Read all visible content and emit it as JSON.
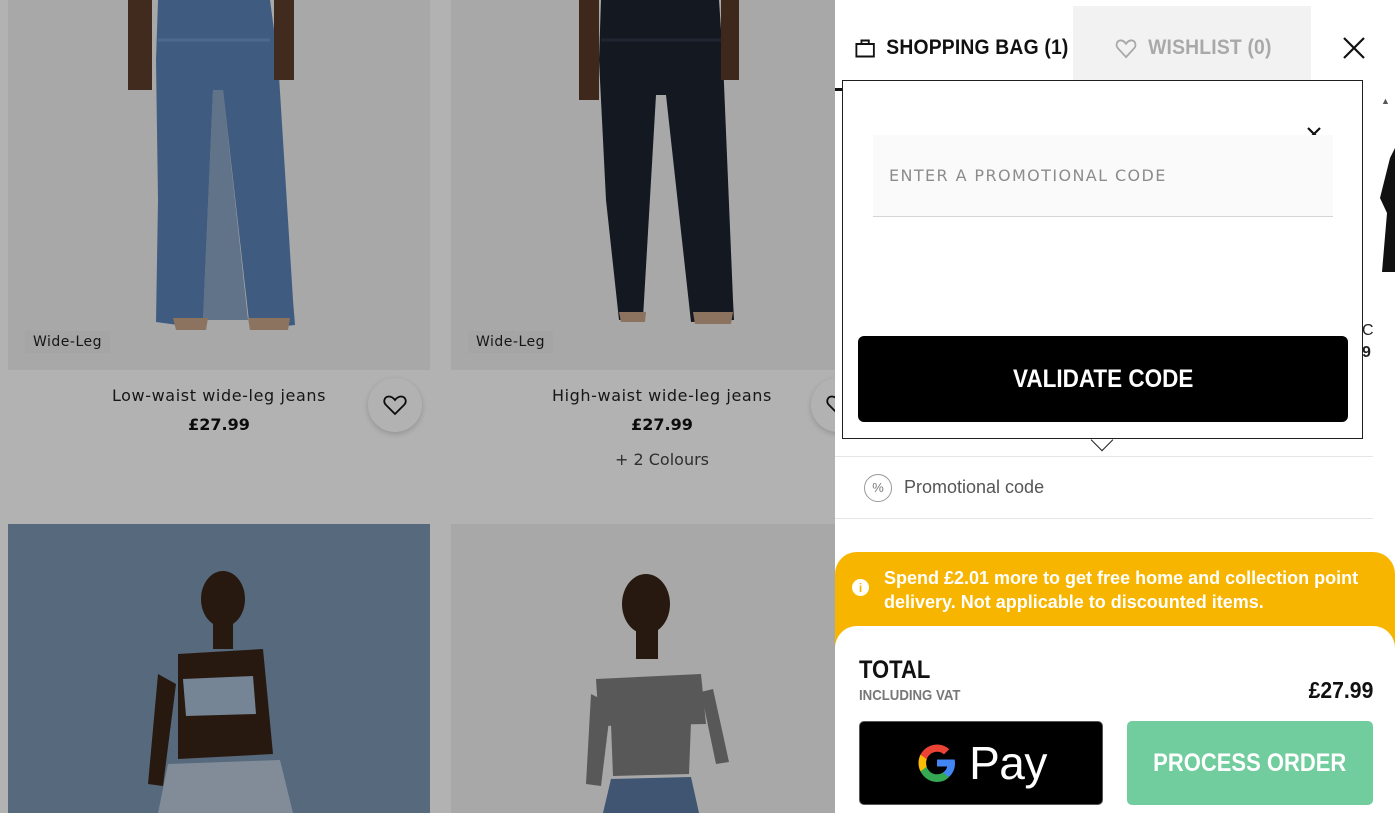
{
  "products": [
    {
      "name": "Low-waist wide-leg jeans",
      "price": "£27.99",
      "badge": "Wide-Leg",
      "colours": ""
    },
    {
      "name": "High-waist wide-leg jeans",
      "price": "£27.99",
      "badge": "Wide-Leg",
      "colours": "+ 2 Colours"
    }
  ],
  "drawer": {
    "tab_bag": "SHOPPING BAG (1)",
    "tab_wishlist": "WISHLIST (0)",
    "side_fragment_1": "C",
    "side_fragment_2": "9"
  },
  "promo": {
    "placeholder": "ENTER A PROMOTIONAL CODE",
    "validate_label": "VALIDATE CODE",
    "row_label": "Promotional code",
    "row_icon": "%"
  },
  "notice": {
    "text": "Spend £2.01 more to get free home and collection point delivery. Not applicable to discounted items.",
    "icon": "i"
  },
  "totals": {
    "label": "TOTAL",
    "vat": "INCLUDING VAT",
    "price": "£27.99",
    "gpay_label": "Pay",
    "process_label": "PROCESS ORDER"
  },
  "colors": {
    "notice_bg": "#f7b500",
    "process_btn": "#71cc9e",
    "validate_btn": "#000000"
  }
}
